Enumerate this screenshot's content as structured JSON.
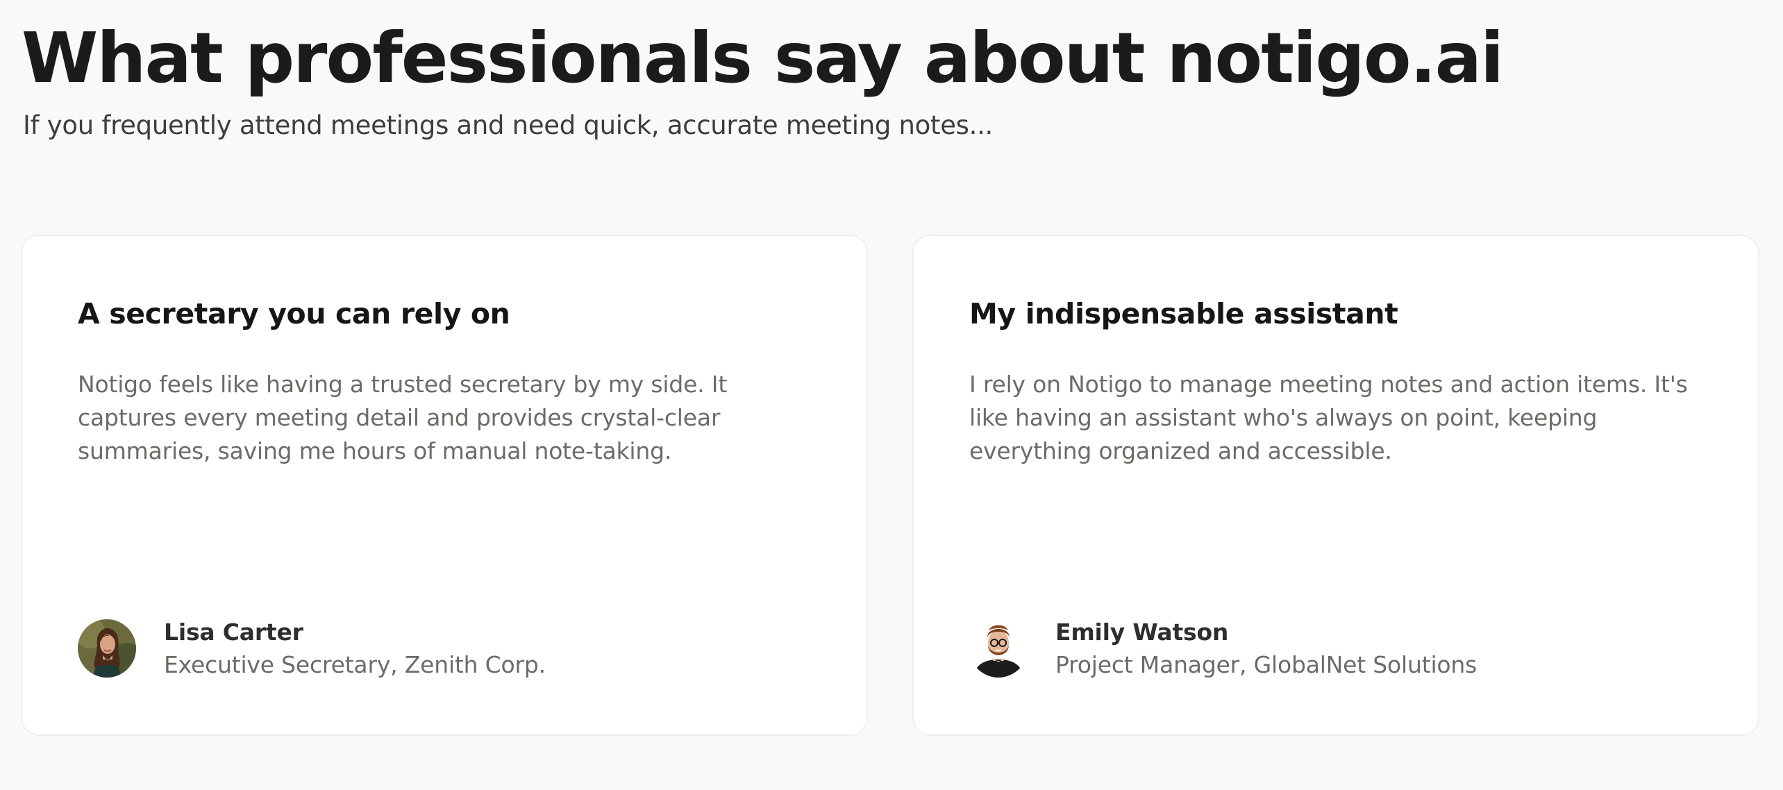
{
  "section": {
    "title": "What professionals say about notigo.ai",
    "subtitle": "If you frequently attend meetings and need quick, accurate meeting notes..."
  },
  "testimonials": [
    {
      "title": "A secretary you can rely on",
      "quote": "Notigo feels like having a trusted secretary by my side. It captures every meeting detail and provides crystal-clear summaries, saving me hours of manual note-taking.",
      "author_name": "Lisa Carter",
      "author_role": "Executive Secretary, Zenith Corp.",
      "avatar_icon": "woman-portrait-avatar"
    },
    {
      "title": "My indispensable assistant",
      "quote": "I rely on Notigo to manage meeting notes and action items. It's like having an assistant who's always on point, keeping everything organized and accessible.",
      "author_name": "Emily Watson",
      "author_role": "Project Manager, GlobalNet Solutions",
      "avatar_icon": "bearded-man-cartoon-avatar"
    }
  ],
  "colors": {
    "background": "#f8f9fb",
    "card_background": "#ffffff",
    "card_border": "#eceef2",
    "heading": "#1b1b1b",
    "body_text": "#6e6a66"
  }
}
